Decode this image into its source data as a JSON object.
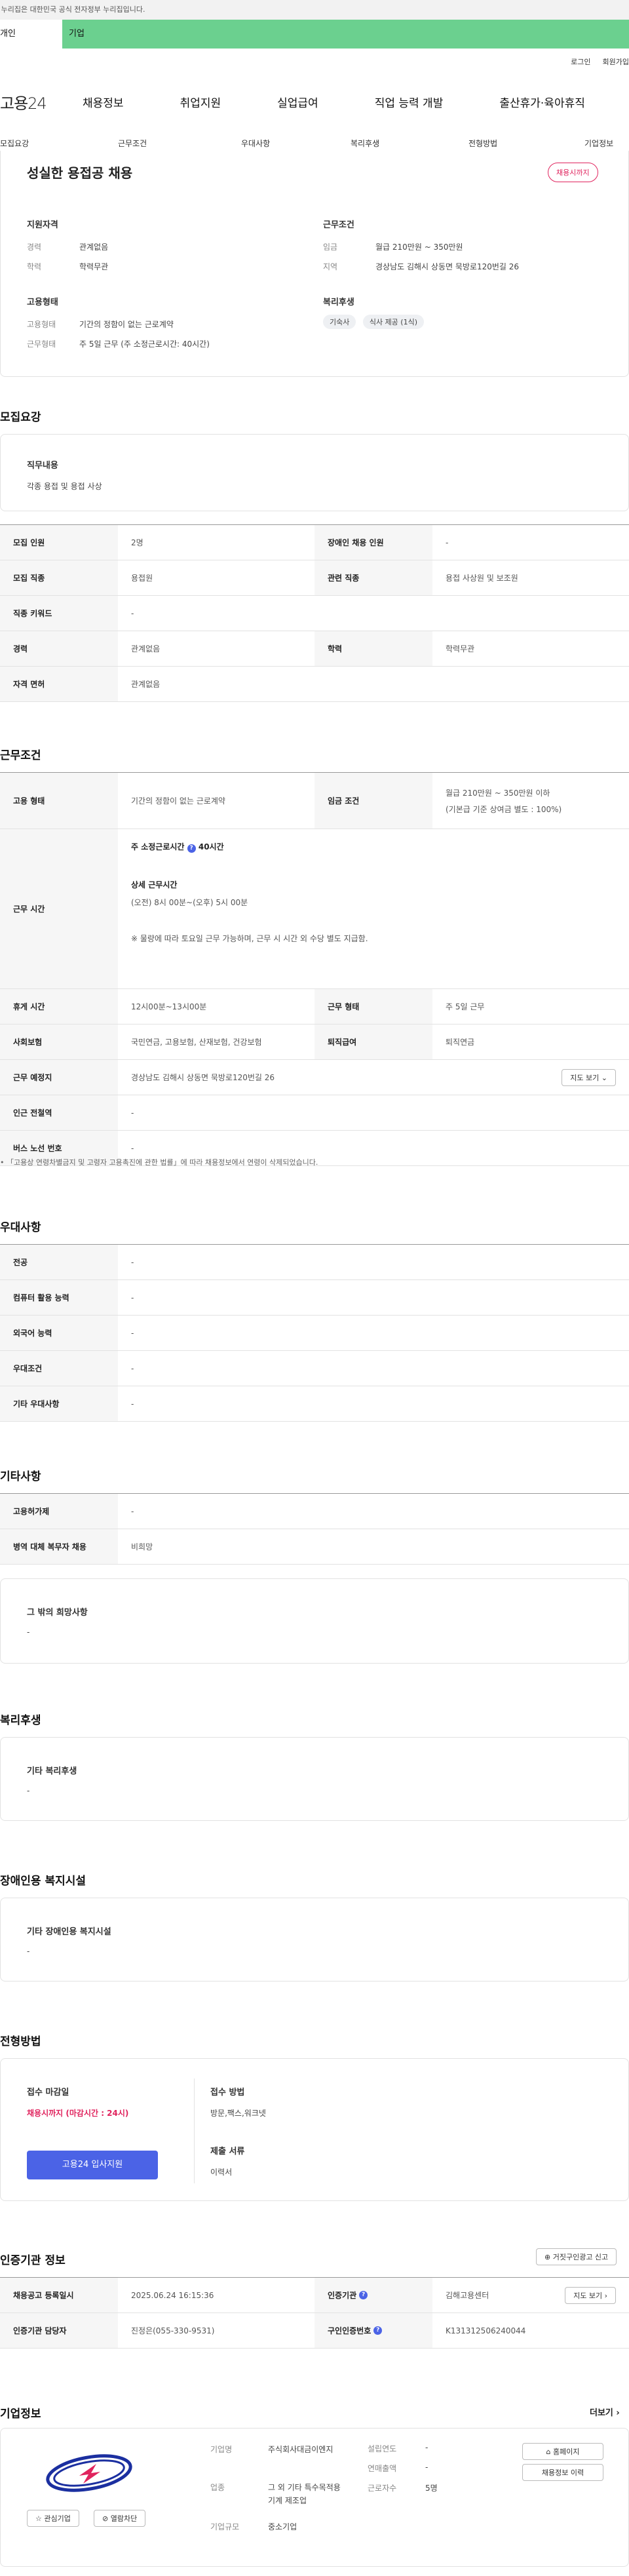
{
  "gov_banner": "이 누리집은 대한민국 공식 전자정부 누리집입니다.",
  "top_tabs": [
    "개인",
    "기업"
  ],
  "util": [
    "로그인",
    "회원가입"
  ],
  "logo": "고용24",
  "gnb": [
    "채용정보",
    "취업지원",
    "실업급여",
    "직업 능력 개발",
    "출산휴가·육아휴직"
  ],
  "lnb": [
    "모집요강",
    "근무조건",
    "우대사항",
    "복리후생",
    "전형방법",
    "기업정보"
  ],
  "summary": {
    "title": "성실한 용접공 채용",
    "badge": "채용시까지",
    "qual_title": "지원자격",
    "career_k": "경력",
    "career_v": "관계없음",
    "edu_k": "학력",
    "edu_v": "학력무관",
    "cond_title": "근무조건",
    "wage_k": "임금",
    "wage_v": "월급 210만원 ~ 350만원",
    "area_k": "지역",
    "area_v": "경상남도 김해시 상동면 묵방로120번길 26",
    "emp_title": "고용형태",
    "emp_k": "고용형태",
    "emp_v": "기간의 정함이 없는 근로계약",
    "week_k": "근무형태",
    "week_v": "주 5일 근무 (주 소정근로시간: 40시간)",
    "welfare_title": "복리후생",
    "welfare_tags": [
      "기숙사",
      "식사 제공 (1식)"
    ]
  },
  "recruit": {
    "heading": "모집요강",
    "duty_label": "직무내용",
    "duty_value": "각종 용접 및 용접 사상",
    "rows": [
      {
        "k1": "모집 인원",
        "v1": "2명",
        "k2": "장애인 채용 인원",
        "v2": "-"
      },
      {
        "k1": "모집 직종",
        "v1": "용접원",
        "k2": "관련 직종",
        "v2": "용접 사상원 및 보조원"
      },
      {
        "k1": "직종 키워드",
        "v1": "-"
      },
      {
        "k1": "경력",
        "v1": "관계없음",
        "k2": "학력",
        "v2": "학력무관"
      },
      {
        "k1": "자격 면허",
        "v1": "관계없음"
      }
    ]
  },
  "conditions": {
    "heading": "근무조건",
    "emp_k": "고용 형태",
    "emp_v": "기간의 정함이 없는 근로계약",
    "wage_k": "임금 조건",
    "wage_v1": "월급 210만원 ~ 350만원 이하",
    "wage_v2": "(기본급 기준 상여금 별도 : 100%)",
    "time_k": "근무 시간",
    "time_t1": "주 소정근로시간",
    "time_t1v": "40시간",
    "time_t2": "상세 근무시간",
    "time_t2v": "(오전) 8시 00분~(오후) 5시 00분",
    "time_note": "※ 물량에 따라 토요일 근무 가능하며, 근무 시 시간 외 수당 별도 지급함.",
    "rest_k": "휴게 시간",
    "rest_v": "12시00분~13시00분",
    "form_k": "근무 형태",
    "form_v": "주 5일 근무",
    "ins_k": "사회보험",
    "ins_v": "국민연금, 고용보험, 산재보험, 건강보험",
    "ret_k": "퇴직급여",
    "ret_v": "퇴직연금",
    "place_k": "근무 예정지",
    "place_v": "경상남도 김해시 상동면 묵방로120번길 26",
    "map_btn": "지도 보기",
    "subway_k": "인근 전철역",
    "subway_v": "-",
    "bus_k": "버스 노선 번호",
    "bus_v": "-",
    "footnote": "「고용상 연령차별금지 및 고령자 고용촉진에 관한 법률」에 따라 채용정보에서 연령이 삭제되었습니다."
  },
  "pref": {
    "heading": "우대사항",
    "rows": [
      [
        "전공",
        "-"
      ],
      [
        "컴퓨터 활용 능력",
        "-"
      ],
      [
        "외국어 능력",
        "-"
      ],
      [
        "우대조건",
        "-"
      ],
      [
        "기타 우대사항",
        "-"
      ]
    ]
  },
  "etc": {
    "heading": "기타사항",
    "rows": [
      [
        "고용허가제",
        "-"
      ],
      [
        "병역 대체 복무자 채용",
        "비희망"
      ]
    ],
    "extra_label": "그 밖의 희망사항",
    "extra_value": "-"
  },
  "welfare": {
    "heading": "복리후생",
    "label": "기타 복리후생",
    "value": "-"
  },
  "disab": {
    "heading": "장애인용 복지시설",
    "label": "기타 장애인용 복지시설",
    "value": "-"
  },
  "process": {
    "heading": "전형방법",
    "deadline_label": "접수 마감일",
    "deadline_value": "채용시까지 (마감시간 : 24시)",
    "apply_btn": "고용24 입사지원",
    "method_label": "접수 방법",
    "method_value": "방문,팩스,워크넷",
    "docs_label": "제출 서류",
    "docs_value": "이력서"
  },
  "cert": {
    "heading": "인증기관 정보",
    "report_btn": "거짓구인광고 신고",
    "reg_k": "채용공고 등록일시",
    "reg_v": "2025.06.24 16:15:36",
    "org_k": "인증기관",
    "org_v": "김해고용센터",
    "map_btn": "지도 보기",
    "mgr_k": "인증기관 담당자",
    "mgr_v": "진정은(055-330-9531)",
    "num_k": "구인인증번호",
    "num_v": "K131312506240044"
  },
  "company": {
    "heading": "기업정보",
    "more": "더보기",
    "fav_btn": "관심기업",
    "block_btn": "열람차단",
    "type_k": "기업명",
    "type_v": "주식회사대금이엔지",
    "ind_k": "업종",
    "ind_v": "그 외 기타 특수목적용 기계 제조업",
    "size_k": "기업규모",
    "size_v": "중소기업",
    "year_k": "설립연도",
    "year_v": "-",
    "rev_k": "연매출액",
    "rev_v": "-",
    "emp_k": "근로자수",
    "emp_v": "5명",
    "home_btn": "홈페이지",
    "hist_btn": "채용정보 이력"
  },
  "colors": {
    "accent_green": "#6bd08f",
    "primary_blue": "#4b63e6",
    "alert_red": "#e0245e"
  }
}
